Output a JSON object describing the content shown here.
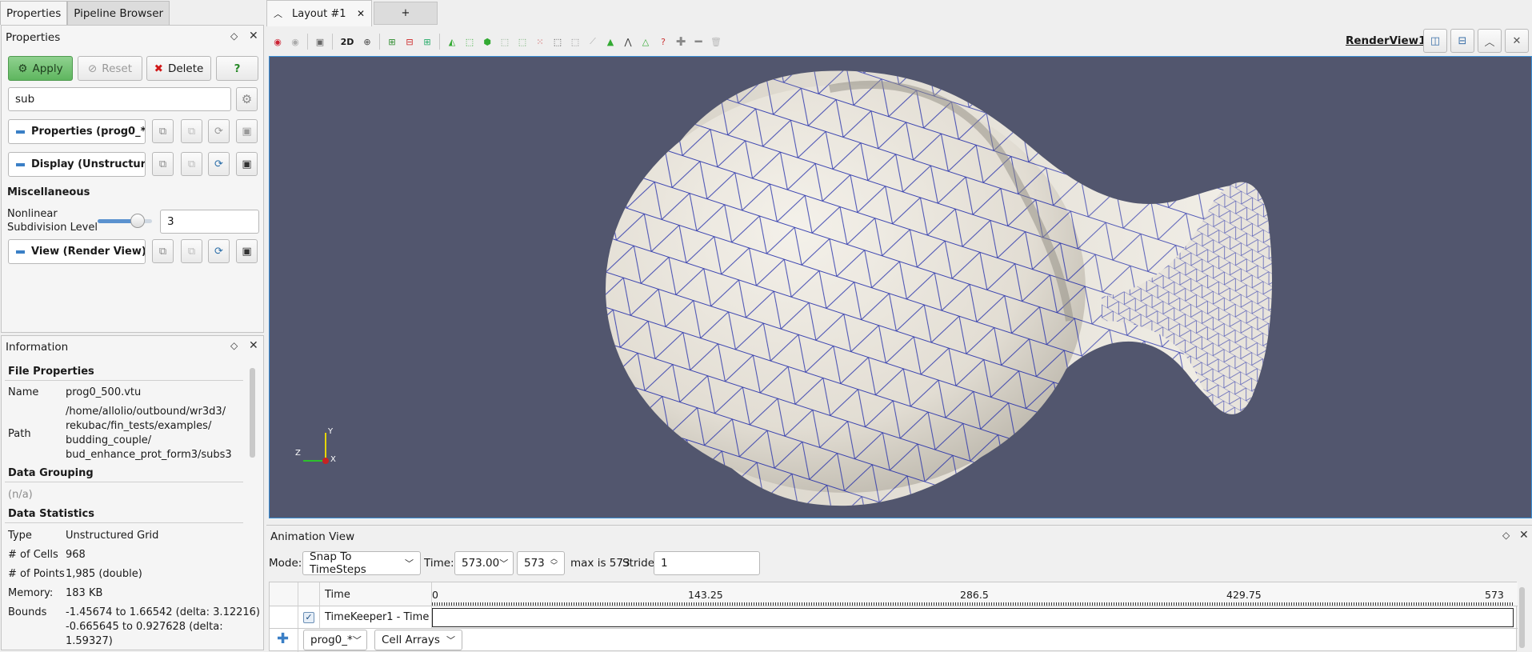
{
  "left_tabs": [
    "Properties",
    "Pipeline Browser"
  ],
  "properties_panel": {
    "title": "Properties",
    "apply": "Apply",
    "reset": "Reset",
    "delete": "Delete",
    "help": "?",
    "search_value": "sub",
    "sections": {
      "properties": "Properties (prog0_*)",
      "display": "Display (Unstructured",
      "view": "View (Render View)"
    },
    "misc_title": "Miscellaneous",
    "nonlinear_label_1": "Nonlinear",
    "nonlinear_label_2": "Subdivision Level",
    "nonlinear_value": "3",
    "slider_fraction": 0.73
  },
  "information_panel": {
    "title": "Information",
    "file_properties": "File Properties",
    "name_label": "Name",
    "name_value": "prog0_500.vtu",
    "path_label": "Path",
    "path_lines": [
      "/home/allolio/outbound/wr3d3/",
      "rekubac/fin_tests/examples/",
      "budding_couple/",
      "bud_enhance_prot_form3/subs3"
    ],
    "data_grouping": "Data Grouping",
    "na": "(n/a)",
    "data_statistics": "Data Statistics",
    "type_label": "Type",
    "type_value": "Unstructured Grid",
    "cells_label": "# of Cells",
    "cells_value": "968",
    "points_label": "# of Points",
    "points_value": "1,985 (double)",
    "memory_label": "Memory:",
    "memory_value": "183 KB",
    "bounds_label": "Bounds",
    "bounds_lines": [
      "-1.45674 to 1.66542 (delta: 3.12216)",
      "-0.665645 to 0.927628 (delta:",
      "1.59327)"
    ]
  },
  "layout_tabs": {
    "current": "Layout #1",
    "add": "+"
  },
  "render_view": {
    "name": "RenderView1",
    "twod": "2D",
    "axes": {
      "y": "Y",
      "z": "Z",
      "x": "X"
    }
  },
  "animation": {
    "title": "Animation View",
    "mode_label": "Mode:",
    "mode_value": "Snap To TimeSteps",
    "time_label": "Time:",
    "time_value": "573.00",
    "step_value": "573",
    "max_text": "max is 573",
    "stride_label": "Stride",
    "stride_value": "1",
    "col_time": "Time",
    "ticks": [
      "0",
      "143.25",
      "286.5",
      "429.75",
      "573"
    ],
    "track_label": "TimeKeeper1 - Time",
    "track_checked": true,
    "source_select": "prog0_*",
    "arrays_select": "Cell Arrays"
  },
  "colors": {
    "viewport_bg": "#52566e",
    "mesh": "#1f2aa8",
    "apply_green": "#5fb65f",
    "accent_blue": "#3a7fc6"
  }
}
